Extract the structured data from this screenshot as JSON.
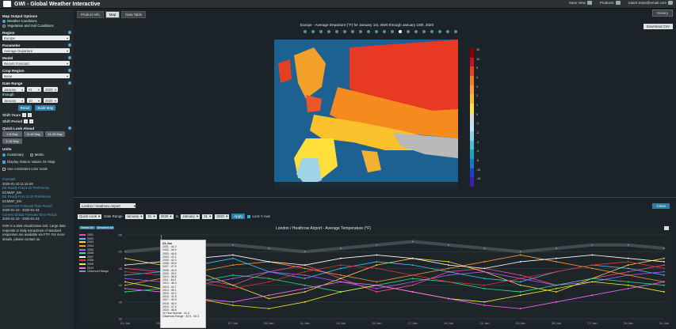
{
  "app": {
    "title": "GWI - Global Weather Interactive"
  },
  "topbar": {
    "save_view": "Save View",
    "products": "Products",
    "user": "robert.trane@email.com"
  },
  "sidebar": {
    "map_output_options": "Map Output Options",
    "weather_conditions": "Weather Conditions",
    "vegetation": "Vegetation and Soil Conditions",
    "region_label": "Region",
    "region_value": "Europe",
    "parameter_label": "Parameter",
    "parameter_value": "Average Departure",
    "model_label": "Model",
    "model_value": "Recent Forecast",
    "crop_label": "Crop Region",
    "crop_value": "None",
    "date_range_label": "Date Range",
    "start_month": "January",
    "start_day": "01",
    "start_year": "2020",
    "through_label": "through",
    "end_month": "January",
    "end_day": "10",
    "end_year": "2020",
    "reset": "Reset",
    "build_map": "Build Map",
    "shift_years": "Shift Years",
    "shift_period": "Shift Period",
    "quick_look": "Quick Look Ahead",
    "ql_1": "1-5 Day",
    "ql_2": "6-10 Day",
    "ql_3": "11-15 Day",
    "ql_4": "1-15 Day",
    "units_label": "Units",
    "customary": "Customary",
    "metric": "Metric",
    "display_station": "Display Station Values On Map",
    "consistent_scale": "Use consistent color scale",
    "forecast_label": "Forecast",
    "forecast_value": "2020-01-10 11:31:09",
    "ens_label_1": "EE Ready Fcst 6-10 Preference",
    "ens_value_1": "ECMWF_EN",
    "ens_label_2": "EE Ready Fcst 11-15 Preference",
    "ens_value_2": "ECMWF_EN",
    "obs_label": "Current GG Forecast Time Period",
    "obs_value": "2020-01-10 - 2020-01-24",
    "fc_label": "Current Global Forecast Time Period",
    "fc_value": "2020-01-10 - 2020-01-24",
    "note": "GWI is a data visualization tool. Large data requests or daily extractions of standard responses are available via FTP. For more details, please contact us."
  },
  "main": {
    "tabs": [
      "Product Info",
      "Map",
      "Data Table"
    ],
    "history": "History",
    "download_csv": "Download CSV",
    "map_title": "Europe - Average Departure (°F) for January 1st, 2020 through January 10th, 2020",
    "legend_labels": [
      "15",
      "10",
      "5",
      "4",
      "3",
      "2",
      "1",
      "0",
      "-1",
      "-2",
      "-3",
      "-4",
      "-5",
      "-10",
      "-15"
    ],
    "station_select": "London / Heathrow Airport",
    "close": "Close",
    "quick_look": "Quick Look",
    "date_range": "Date Range",
    "start_month": "January",
    "start_day": "01",
    "start_year": "2020",
    "to": "to",
    "end_month": "January",
    "end_day": "31",
    "end_year": "2020",
    "apply": "Apply",
    "lock_axis": "Lock Y Axis"
  },
  "chart_data": {
    "type": "line",
    "title": "London / Heathrow Airport - Average Temperature (°F)",
    "xlabel": "",
    "ylabel": "",
    "categories": [
      "01-Jan",
      "03-Jan",
      "05-Jan",
      "07-Jan",
      "09-Jan",
      "11-Jan",
      "13-Jan",
      "15-Jan",
      "17-Jan",
      "19-Jan",
      "21-Jan",
      "23-Jan",
      "25-Jan",
      "27-Jan",
      "29-Jan",
      "31-Jan"
    ],
    "ylim": [
      30,
      55
    ],
    "buttons": [
      "Select All",
      "Deselect All"
    ],
    "series": [
      {
        "name": "2001",
        "color": "#ff4a8d",
        "values": [
          45,
          44,
          42,
          40,
          44,
          46,
          42,
          38,
          40,
          44,
          45,
          43,
          40,
          42,
          44,
          46
        ]
      },
      {
        "name": "2002",
        "color": "#44c2ff",
        "values": [
          43,
          44,
          46,
          48,
          44,
          42,
          45,
          47,
          46,
          44,
          42,
          41,
          44,
          46,
          45,
          43
        ]
      },
      {
        "name": "2003",
        "color": "#ffd54a",
        "values": [
          48,
          46,
          44,
          40,
          36,
          38,
          42,
          46,
          48,
          47,
          44,
          40,
          38,
          42,
          46,
          48
        ]
      },
      {
        "name": "2004",
        "color": "#ff9a2e",
        "values": [
          40,
          42,
          44,
          46,
          47,
          45,
          43,
          41,
          43,
          45,
          47,
          49,
          47,
          45,
          43,
          41
        ]
      },
      {
        "name": "2005",
        "color": "#b35cff",
        "values": [
          42,
          41,
          40,
          42,
          44,
          43,
          41,
          39,
          41,
          43,
          44,
          42,
          40,
          41,
          43,
          44
        ]
      },
      {
        "name": "2006",
        "color": "#33e08a",
        "values": [
          38,
          39,
          41,
          43,
          42,
          40,
          38,
          40,
          42,
          41,
          39,
          38,
          40,
          42,
          41,
          40
        ]
      },
      {
        "name": "2007",
        "color": "#ffffff",
        "values": [
          46,
          47,
          48,
          49,
          47,
          46,
          48,
          49,
          48,
          46,
          45,
          47,
          48,
          49,
          48,
          47
        ]
      },
      {
        "name": "2008",
        "color": "#e83030",
        "values": [
          44,
          43,
          41,
          39,
          41,
          44,
          46,
          45,
          43,
          41,
          40,
          42,
          44,
          46,
          47,
          45
        ]
      },
      {
        "name": "2009",
        "color": "#f1f130",
        "values": [
          41,
          39,
          36,
          34,
          33,
          35,
          38,
          40,
          38,
          36,
          35,
          37,
          39,
          41,
          40,
          38
        ]
      },
      {
        "name": "2010",
        "color": "#ff66ff",
        "values": [
          39,
          38,
          36,
          35,
          37,
          39,
          41,
          40,
          38,
          36,
          34,
          33,
          35,
          37,
          39,
          41
        ]
      },
      {
        "name": "Observed Range",
        "color": "#8a9499",
        "values": [
          50,
          51,
          52,
          52,
          51,
          50,
          51,
          52,
          53,
          52,
          51,
          50,
          51,
          52,
          52,
          51
        ]
      }
    ],
    "tooltip": {
      "header": "03-Jan",
      "rows": [
        "2001 : 44.2",
        "2002 : 46.9",
        "2003 : 46.8",
        "2004 : 42.1",
        "2005 : 42.0",
        "2006 : 39.8",
        "2007 : 47.6",
        "2008 : 43.9",
        "2009 : 39.2",
        "2010 : 38.5",
        "2011 : 46.0",
        "2012 : 48.3",
        "2013 : 44.7",
        "2014 : 45.1",
        "2015 : 43.2",
        "2016 : 41.8",
        "2017 : 40.9",
        "2018 : 46.0",
        "2019 : 47.4",
        "2020 : 46.8",
        "30 Year Normal : 41.3",
        "Observed Range : 32.5 - 53.3"
      ]
    }
  }
}
